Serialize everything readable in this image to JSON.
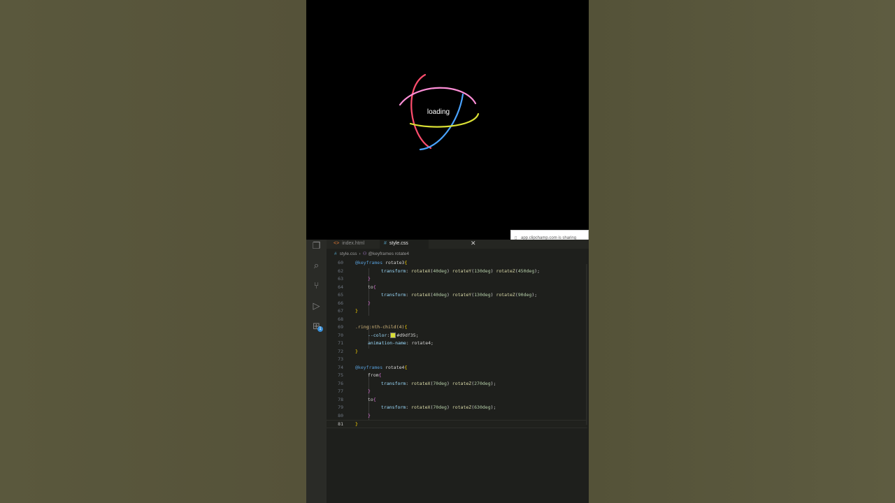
{
  "preview": {
    "loading_text": "loading",
    "ring_colors": [
      "#ff4d6d",
      "#ff8fd8",
      "#4aa3ff",
      "#d9df35"
    ]
  },
  "share_popup": {
    "text": "app.clipchamp.com is sharing"
  },
  "editor": {
    "tabs": [
      {
        "label": "index.html",
        "icon": "html-file-icon",
        "active": false
      },
      {
        "label": "style.css",
        "icon": "css-file-icon",
        "active": true
      }
    ],
    "breadcrumb": {
      "file": "style.css",
      "symbol": "@keyframes rotate4"
    },
    "activity_icons": [
      "explorer-icon",
      "search-icon",
      "source-control-icon",
      "run-debug-icon",
      "extensions-icon"
    ],
    "extensions_badge": "1",
    "lines": [
      {
        "n": "60",
        "text": "@keyframes rotate3{"
      },
      {
        "n": "62",
        "text": "transform: rotateX(40deg) rotateY(130deg) rotateZ(450deg);"
      },
      {
        "n": "63",
        "text": "}"
      },
      {
        "n": "64",
        "text": "to{"
      },
      {
        "n": "65",
        "text": "transform: rotateX(40deg) rotateY(130deg) rotateZ(90deg);"
      },
      {
        "n": "66",
        "text": "}"
      },
      {
        "n": "67",
        "text": "}"
      },
      {
        "n": "68",
        "text": ""
      },
      {
        "n": "69",
        "text": ".ring:nth-child(4){"
      },
      {
        "n": "70",
        "text": "--color: #d9df35;"
      },
      {
        "n": "71",
        "text": "animation-name: rotate4;"
      },
      {
        "n": "72",
        "text": "}"
      },
      {
        "n": "73",
        "text": ""
      },
      {
        "n": "74",
        "text": "@keyframes rotate4{"
      },
      {
        "n": "75",
        "text": "from{"
      },
      {
        "n": "76",
        "text": "transform: rotateX(70deg) rotateZ(270deg);"
      },
      {
        "n": "77",
        "text": "}"
      },
      {
        "n": "78",
        "text": "to{"
      },
      {
        "n": "79",
        "text": "transform: rotateX(70deg) rotateZ(630deg);"
      },
      {
        "n": "80",
        "text": "}"
      },
      {
        "n": "81",
        "text": "}"
      }
    ]
  }
}
